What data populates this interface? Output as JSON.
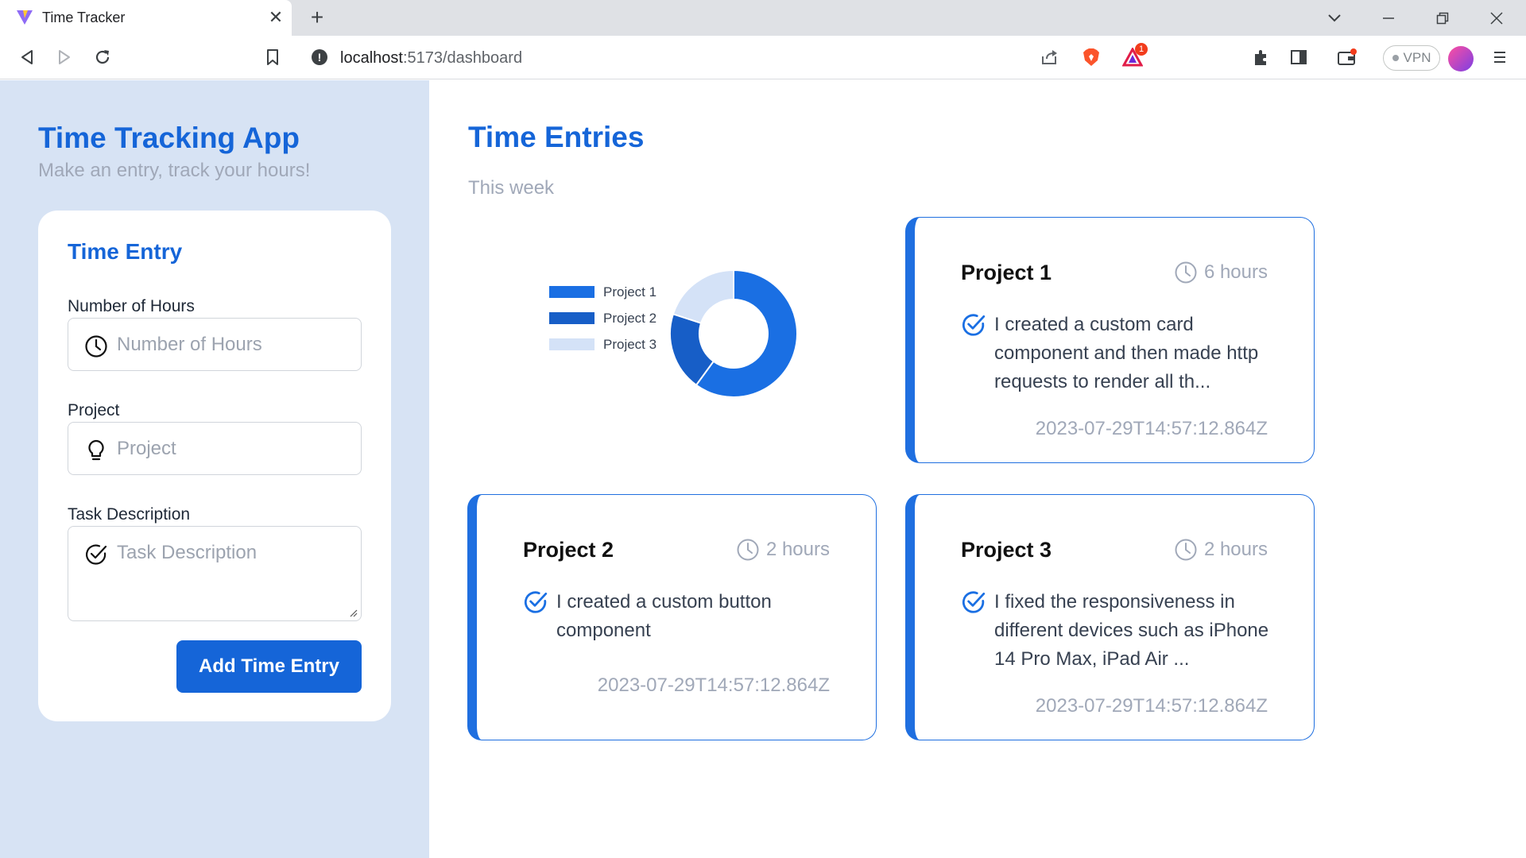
{
  "browser": {
    "tab_title": "Time Tracker",
    "url_host": "localhost",
    "url_path": ":5173/dashboard",
    "vpn_label": "VPN",
    "alert_badge": "1"
  },
  "sidebar": {
    "title": "Time Tracking App",
    "subtitle": "Make an entry, track your hours!",
    "form": {
      "heading": "Time Entry",
      "hours_label": "Number of Hours",
      "hours_placeholder": "Number of Hours",
      "project_label": "Project",
      "project_placeholder": "Project",
      "task_label": "Task Description",
      "task_placeholder": "Task Description",
      "submit_label": "Add Time Entry"
    }
  },
  "main": {
    "title": "Time Entries",
    "period_label": "This week",
    "entries": [
      {
        "project": "Project 1",
        "hours": "6 hours",
        "description": "I created a custom card component and then made http requests to render all th...",
        "timestamp": "2023-07-29T14:57:12.864Z"
      },
      {
        "project": "Project 2",
        "hours": "2 hours",
        "description": "I created a custom button component",
        "timestamp": "2023-07-29T14:57:12.864Z"
      },
      {
        "project": "Project 3",
        "hours": "2 hours",
        "description": "I fixed the responsiveness in different devices such as iPhone 14 Pro Max, iPad Air ...",
        "timestamp": "2023-07-29T14:57:12.864Z"
      }
    ]
  },
  "chart_data": {
    "type": "pie",
    "donut": true,
    "categories": [
      "Project 1",
      "Project 2",
      "Project 3"
    ],
    "values": [
      6,
      2,
      2
    ],
    "colors": [
      "#1a6fe3",
      "#175ec7",
      "#d4e2f7"
    ],
    "legend_position": "left"
  },
  "colors": {
    "accent": "#1565d8",
    "sidebar_bg": "#d7e3f4",
    "muted_text": "#a0a8b8"
  }
}
